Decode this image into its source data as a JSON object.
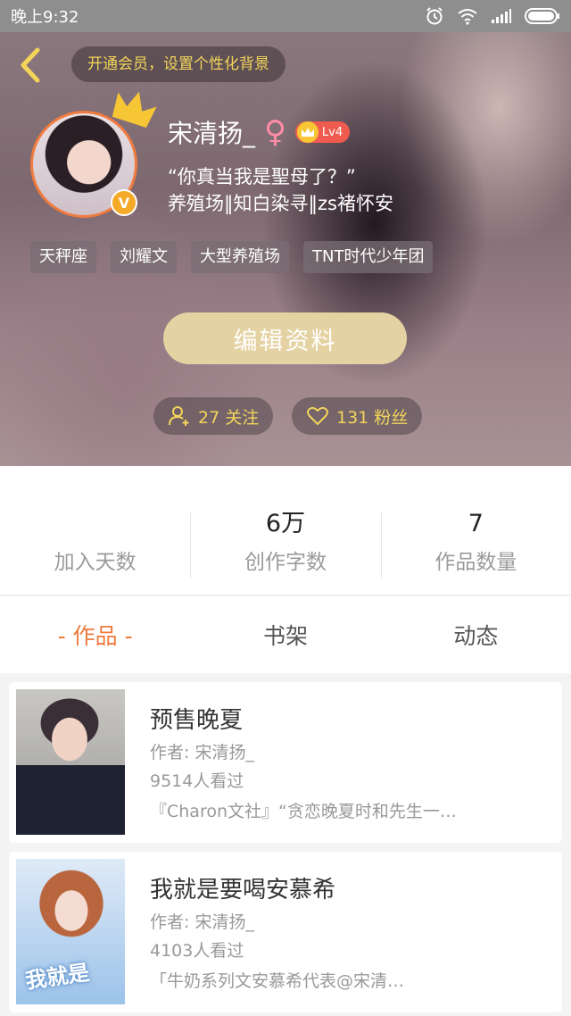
{
  "status": {
    "time": "晚上9:32"
  },
  "header": {
    "vip_prompt": "开通会员，设置个性化背景",
    "username": "宋清扬_",
    "gender_symbol": "♀",
    "level": "Lv4",
    "verified_badge": "V",
    "quote": "“你真当我是聖母了？”",
    "bio": "养殖场‖知白染寻‖zs褚怀安",
    "tags": [
      "天秤座",
      "刘耀文",
      "大型养殖场",
      "TNT时代少年团"
    ],
    "edit_button": "编辑资料",
    "following": "27 关注",
    "followers": "131 粉丝",
    "accent_color": "#f3d55a"
  },
  "stats": [
    {
      "value": "",
      "label": "加入天数"
    },
    {
      "value": "6万",
      "label": "创作字数"
    },
    {
      "value": "7",
      "label": "作品数量"
    }
  ],
  "tabs": [
    {
      "label": "- 作品 -",
      "active": true
    },
    {
      "label": "书架",
      "active": false
    },
    {
      "label": "动态",
      "active": false
    }
  ],
  "works": [
    {
      "title": "预售晚夏",
      "author": "作者: 宋清扬_",
      "views": "9514人看过",
      "desc": "『Charon文社』“贪恋晚夏时和先生一…"
    },
    {
      "title": "我就是要喝安慕希",
      "author": "作者: 宋清扬_",
      "views": "4103人看过",
      "desc": "「牛奶系列文安慕希代表@宋清…",
      "cover_text": "我就是"
    }
  ],
  "colors": {
    "active_tab": "#f07b3f",
    "edit_button": "#e5d2a2",
    "avatar_border": "#f07b3f"
  }
}
